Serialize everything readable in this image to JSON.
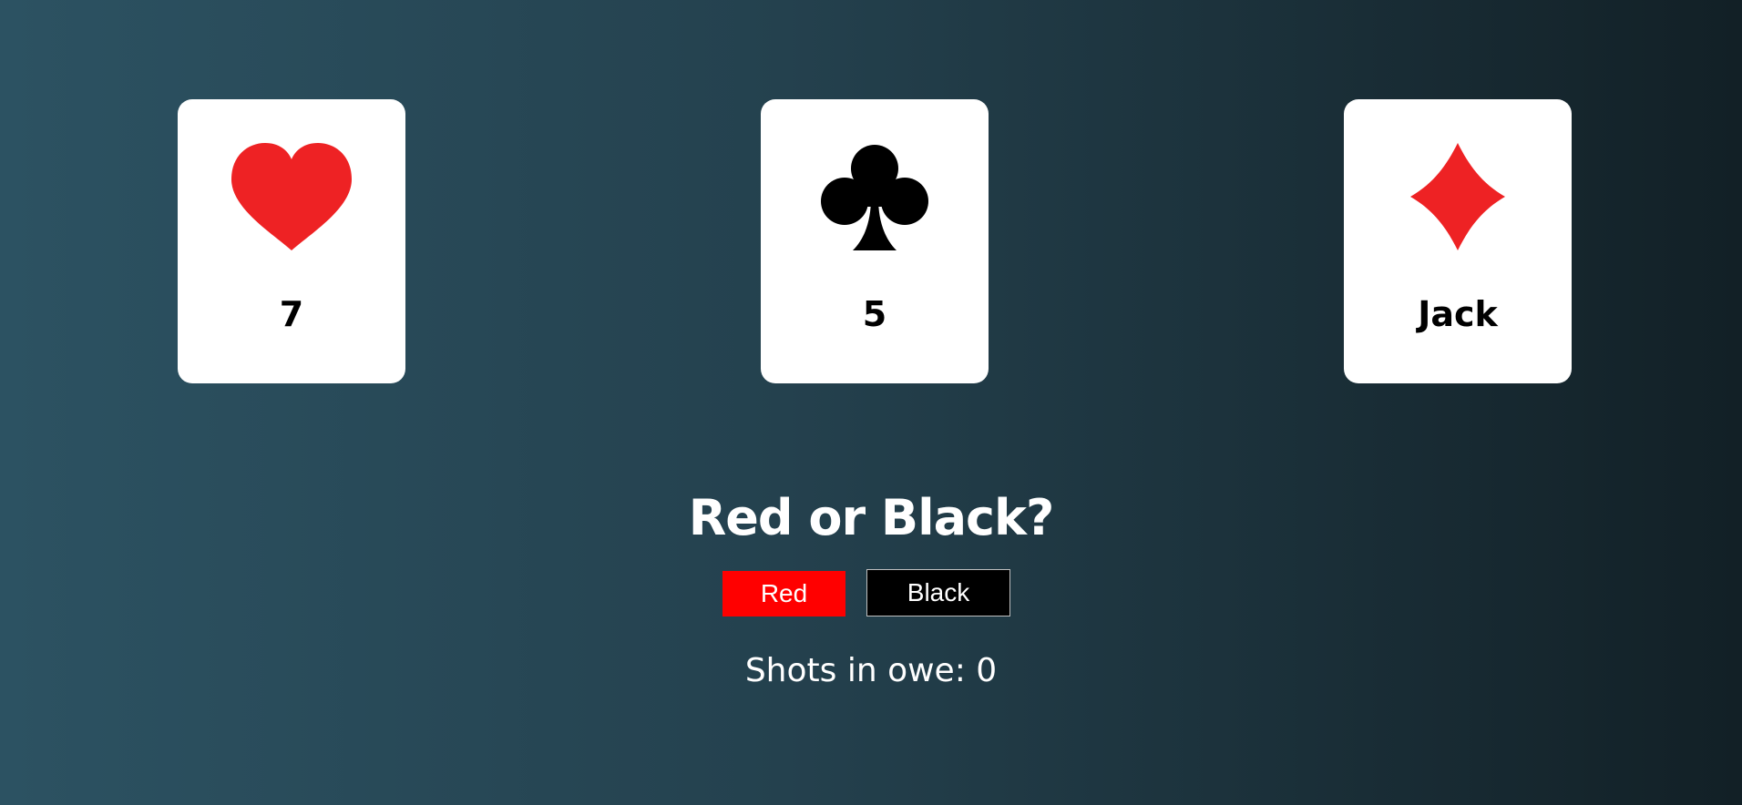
{
  "cards": [
    {
      "suit": "heart-icon",
      "suit_color": "#ee2224",
      "rank": "7"
    },
    {
      "suit": "club-icon",
      "suit_color": "#000000",
      "rank": "5"
    },
    {
      "suit": "diamond-icon",
      "suit_color": "#ee2224",
      "rank": "Jack"
    }
  ],
  "question": "Red or Black?",
  "buttons": {
    "red_label": "Red",
    "black_label": "Black"
  },
  "shots": {
    "text": "Shots in owe: 0"
  },
  "colors": {
    "red_button": "#ff0000",
    "black_button": "#000000",
    "text": "#ffffff"
  }
}
